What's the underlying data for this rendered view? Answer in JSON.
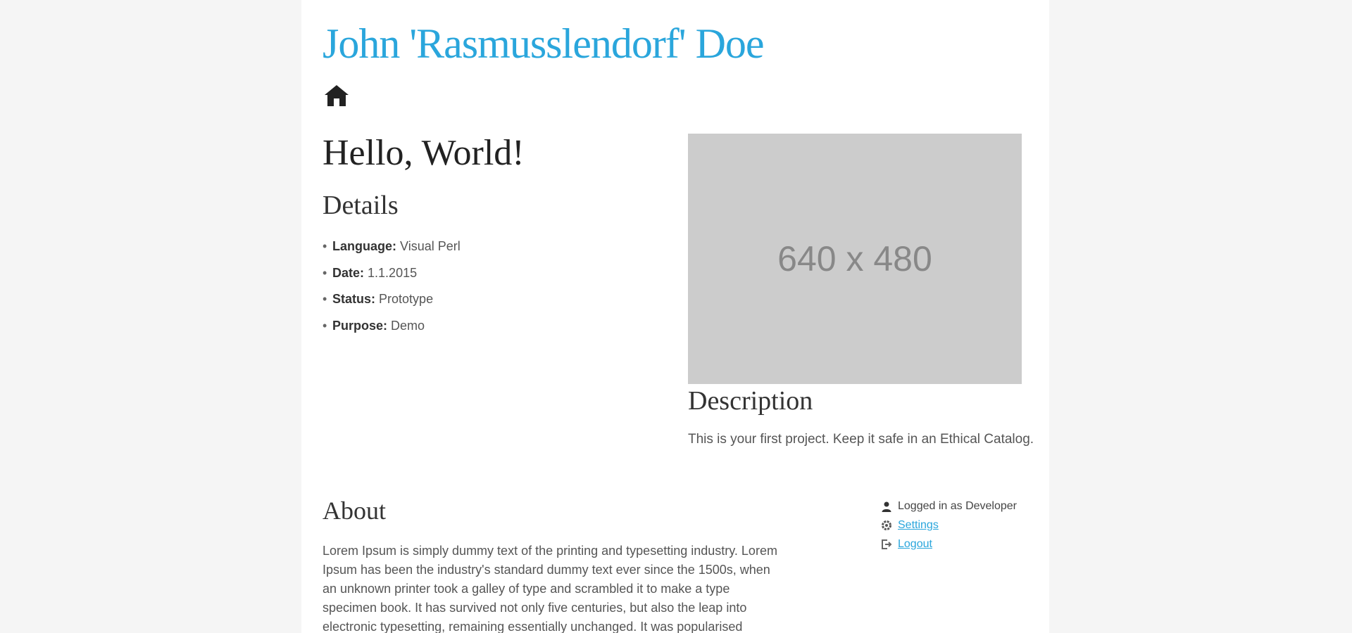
{
  "header": {
    "title": "John 'Rasmusslendorf' Doe",
    "home_icon": "home-icon"
  },
  "project": {
    "heading": "Hello, World!",
    "details_heading": "Details",
    "details": [
      {
        "key": "Language:",
        "value": "Visual Perl"
      },
      {
        "key": "Date:",
        "value": "1.1.2015"
      },
      {
        "key": "Status:",
        "value": "Prototype"
      },
      {
        "key": "Purpose:",
        "value": "Demo"
      }
    ],
    "image_placeholder": "640 x 480",
    "description_heading": "Description",
    "description_text": "This is your first project. Keep it safe in an Ethical Catalog."
  },
  "about": {
    "heading": "About",
    "text": "Lorem Ipsum is simply dummy text of the printing and typesetting industry. Lorem Ipsum has been the industry's standard dummy text ever since the 1500s, when an unknown printer took a galley of type and scrambled it to make a type specimen book. It has survived not only five centuries, but also the leap into electronic typesetting, remaining essentially unchanged. It was popularised"
  },
  "meta": {
    "items": [
      {
        "icon": "user-icon",
        "text": "Logged in as Developer",
        "is_link": false
      },
      {
        "icon": "settings-icon",
        "text": "Settings",
        "is_link": true
      },
      {
        "icon": "logout-icon",
        "text": "Logout",
        "is_link": true
      }
    ]
  },
  "colors": {
    "accent": "#2aa6dc",
    "background": "#f5f5f5",
    "page": "#ffffff",
    "placeholder": "#cccccc"
  }
}
